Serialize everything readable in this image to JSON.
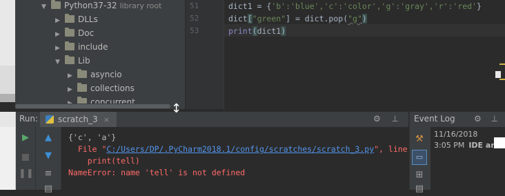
{
  "tree": {
    "items": [
      {
        "label": "Python37-32",
        "suffix": "library root",
        "expanded": true
      },
      {
        "label": "DLLs",
        "expanded": false
      },
      {
        "label": "Doc",
        "expanded": false
      },
      {
        "label": "include",
        "expanded": false
      },
      {
        "label": "Lib",
        "expanded": true
      },
      {
        "label": "asyncio",
        "expanded": false
      },
      {
        "label": "collections",
        "expanded": false
      },
      {
        "label": "concurrent",
        "expanded": false
      }
    ]
  },
  "editor": {
    "lines": [
      {
        "number": "51"
      },
      {
        "number": "52"
      },
      {
        "number": "53"
      }
    ],
    "code": {
      "l51_prefix": "dict1 = {",
      "l51_body": "'b':'blue','c':'color','g':'gray','r':'red'",
      "l51_suffix": "}",
      "l52_a": "dict",
      "l52_b": "[",
      "l52_c": "\"green\"",
      "l52_d": "] = dict.pop(",
      "l52_e": "\"g\"",
      "l52_f": ")",
      "l53_print": "print",
      "l53_open": "(",
      "l53_arg": "dict1",
      "l53_close": ")"
    }
  },
  "run": {
    "label": "Run:",
    "tab": "scratch_3",
    "tab_close": "×",
    "tools": "⚙ ⊥"
  },
  "console": {
    "line1": "{'c', 'a'}",
    "line2_prefix": "  File \"",
    "line2_link": "C:/Users/DP/.PyCharm2018.1/config/scratches/scratch_3.py",
    "line2_suffix": "\", line",
    "line3": "    print(tell)",
    "line4": "NameError: name 'tell' is not defined"
  },
  "event_log": {
    "title": "Event Log",
    "tools": "⚙ ⊥",
    "date": "11/16/2018",
    "time": "3:05 PM",
    "message": "IDE and Pl"
  },
  "colors": {
    "error": "#ff6b68",
    "link": "#5394ec",
    "run_green": "#59a869"
  }
}
